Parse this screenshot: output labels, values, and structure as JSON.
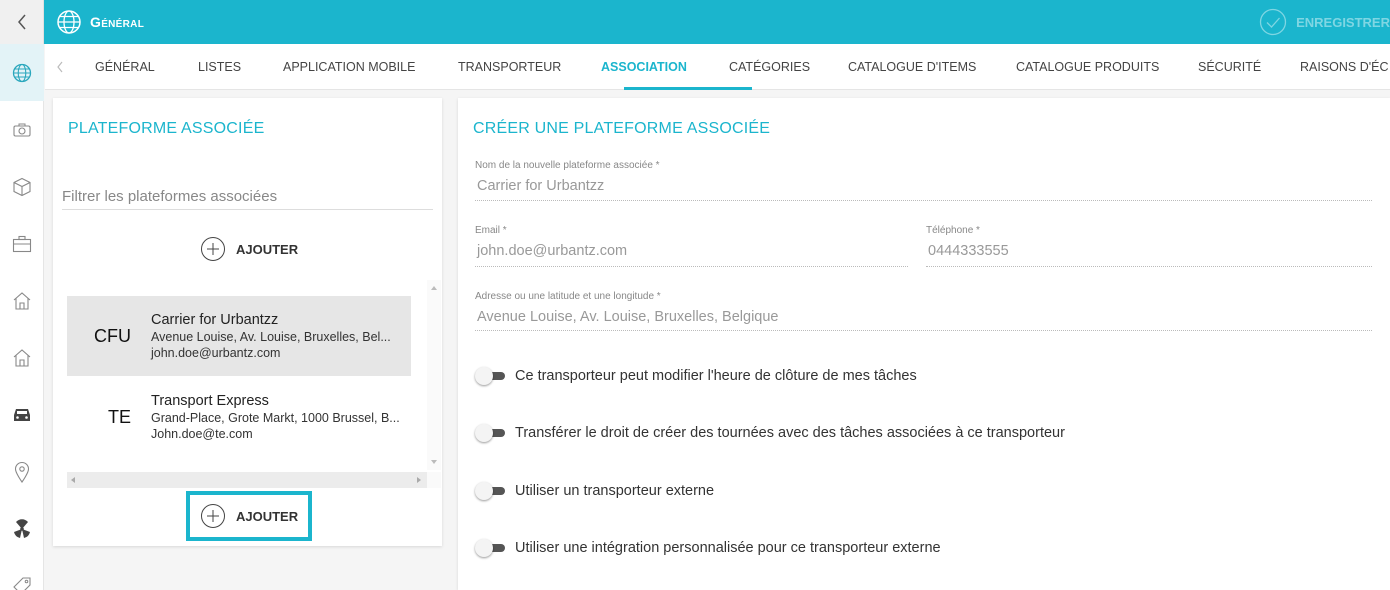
{
  "header": {
    "title": "Général",
    "save_label": "ENREGISTRER"
  },
  "colors": {
    "accent": "#1bb5cd",
    "rail_active": "#e3f3f7",
    "selected_row": "#e6e6e6"
  },
  "rail": {
    "items": [
      "globe-icon",
      "camera-icon",
      "cube-icon",
      "briefcase-icon",
      "home-icon",
      "home-icon",
      "car-icon",
      "location-pin-icon",
      "nuclear-icon",
      "tag-icon"
    ]
  },
  "tabs": [
    {
      "label": "GÉNÉRAL"
    },
    {
      "label": "LISTES"
    },
    {
      "label": "APPLICATION MOBILE"
    },
    {
      "label": "TRANSPORTEUR"
    },
    {
      "label": "ASSOCIATION"
    },
    {
      "label": "CATÉGORIES"
    },
    {
      "label": "CATALOGUE D'ITEMS"
    },
    {
      "label": "CATALOGUE PRODUITS"
    },
    {
      "label": "SÉCURITÉ"
    },
    {
      "label": "RAISONS D'ÉC"
    }
  ],
  "active_tab": "ASSOCIATION",
  "left_panel": {
    "title": "PLATEFORME ASSOCIÉE",
    "filter_placeholder": "Filtrer les plateformes associées",
    "add_label": "AJOUTER",
    "items": [
      {
        "abbr": "CFU",
        "name": "Carrier for Urbantzz",
        "address": "Avenue Louise, Av. Louise, Bruxelles, Bel...",
        "email": "john.doe@urbantz.com"
      },
      {
        "abbr": "TE",
        "name": "Transport Express",
        "address": "Grand-Place, Grote Markt, 1000 Brussel, B...",
        "email": "John.doe@te.com"
      }
    ],
    "add_label_bottom": "AJOUTER"
  },
  "right_panel": {
    "title": "CRÉER UNE PLATEFORME ASSOCIÉE",
    "name_label": "Nom de la nouvelle plateforme associée *",
    "name_value": "Carrier for Urbantzz",
    "email_label": "Email *",
    "email_value": "john.doe@urbantz.com",
    "phone_label": "Téléphone *",
    "phone_value": "0444333555",
    "address_label": "Adresse ou une latitude et une longitude *",
    "address_value": "Avenue Louise, Av. Louise, Bruxelles, Belgique",
    "toggles": [
      {
        "label": "Ce transporteur peut modifier l'heure de clôture de mes tâches",
        "on": false
      },
      {
        "label": "Transférer le droit de créer des tournées avec des tâches associées à ce transporteur",
        "on": false
      },
      {
        "label": "Utiliser un transporteur externe",
        "on": false
      },
      {
        "label": "Utiliser une intégration personnalisée pour ce transporteur externe",
        "on": false
      }
    ]
  }
}
